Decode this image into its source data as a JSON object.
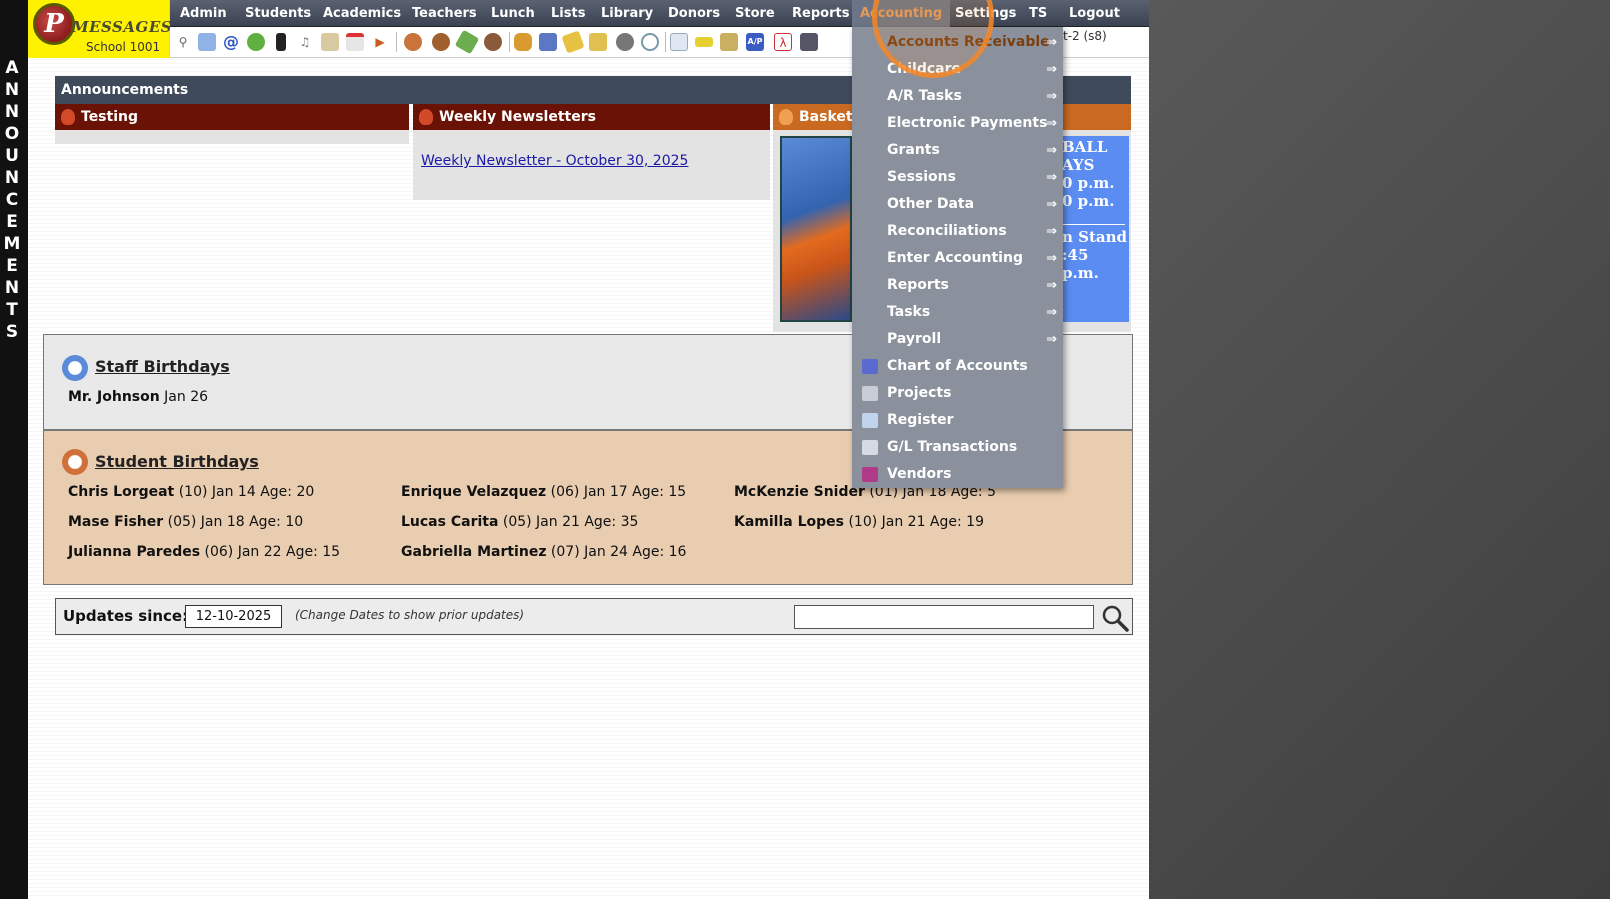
{
  "side_strip": {
    "letters": [
      "A",
      "N",
      "N",
      "O",
      "U",
      "N",
      "C",
      "E",
      "M",
      "E",
      "N",
      "T",
      "S"
    ]
  },
  "logo": {
    "initial": "P",
    "title": "MESSAGES",
    "school": "School 1001"
  },
  "nav": {
    "items": [
      "Admin",
      "Students",
      "Academics",
      "Teachers",
      "Lunch",
      "Lists",
      "Library",
      "Donors",
      "Store",
      "Reports",
      "Accounting",
      "Settings",
      "TS",
      "Logout"
    ],
    "active": "Accounting"
  },
  "toolbar": {
    "user_info": "t-2 (s8)"
  },
  "announcements": {
    "title": "Announcements",
    "columns": [
      {
        "title": "Testing"
      },
      {
        "title": "Weekly Newsletters",
        "link": "Weekly Newsletter - October 30, 2025"
      },
      {
        "title": "Basketb"
      }
    ],
    "bball_lines": [
      "BALL",
      "AYS",
      "0 p.m.",
      "0 p.m.",
      "n Stand",
      ":45 p.m."
    ]
  },
  "staff_birthdays": {
    "title": "Staff Birthdays",
    "entries": [
      {
        "name": "Mr. Johnson",
        "detail": " Jan 26"
      }
    ]
  },
  "student_birthdays": {
    "title": "Student Birthdays",
    "entries": [
      {
        "name": "Chris Lorgeat",
        "detail": " (10) Jan 14 Age: 20"
      },
      {
        "name": "Enrique Velazquez",
        "detail": " (06) Jan 17 Age: 15"
      },
      {
        "name": "McKenzie Snider",
        "detail": " (01) Jan 18 Age: 5"
      },
      {
        "name": "Mase Fisher",
        "detail": " (05) Jan 18 Age: 10"
      },
      {
        "name": "Lucas Carita",
        "detail": " (05) Jan 21 Age: 35"
      },
      {
        "name": "Kamilla Lopes",
        "detail": " (10) Jan 21 Age: 19"
      },
      {
        "name": "Julianna Paredes",
        "detail": " (06) Jan 22 Age: 15"
      },
      {
        "name": "Gabriella Martinez",
        "detail": " (07) Jan 24 Age: 16"
      }
    ]
  },
  "updates": {
    "label": "Updates since:",
    "date": "12-10-2025",
    "hint": "(Change Dates to show prior updates)",
    "search_value": ""
  },
  "accounting_menu": {
    "items": [
      {
        "label": "Accounts Receivable",
        "arrow": "⇒",
        "icon": ""
      },
      {
        "label": "Childcare",
        "arrow": "⇒",
        "icon": ""
      },
      {
        "label": "A/R Tasks",
        "arrow": "⇒",
        "icon": ""
      },
      {
        "label": "Electronic Payments",
        "arrow": "⇒",
        "icon": ""
      },
      {
        "label": "Grants",
        "arrow": "⇒",
        "icon": ""
      },
      {
        "label": "Sessions",
        "arrow": "⇒",
        "icon": ""
      },
      {
        "label": "Other Data",
        "arrow": "⇒",
        "icon": ""
      },
      {
        "label": "Reconciliations",
        "arrow": "⇒",
        "icon": ""
      },
      {
        "label": "Enter Accounting",
        "arrow": "⇒",
        "icon": ""
      },
      {
        "label": "Reports",
        "arrow": "⇒",
        "icon": ""
      },
      {
        "label": "Tasks",
        "arrow": "⇒",
        "icon": ""
      },
      {
        "label": "Payroll",
        "arrow": "⇒",
        "icon": ""
      },
      {
        "label": "Chart of Accounts",
        "arrow": "",
        "icon": "gl-chart-icon"
      },
      {
        "label": "Projects",
        "arrow": "",
        "icon": "projects-list-icon"
      },
      {
        "label": "Register",
        "arrow": "",
        "icon": "register-icon"
      },
      {
        "label": "G/L Transactions",
        "arrow": "",
        "icon": "gl-transactions-icon"
      },
      {
        "label": "Vendors",
        "arrow": "",
        "icon": "vendors-icon"
      }
    ],
    "highlighted": "Accounts Receivable"
  },
  "colors": {
    "nav_bg": "#3b4352",
    "logo_bg": "#fff200",
    "dropdown_bg": "#8a919c",
    "ann_header_red": "#6b1206",
    "ann_header_orange": "#c96a20",
    "click_ring": "#f58728"
  }
}
